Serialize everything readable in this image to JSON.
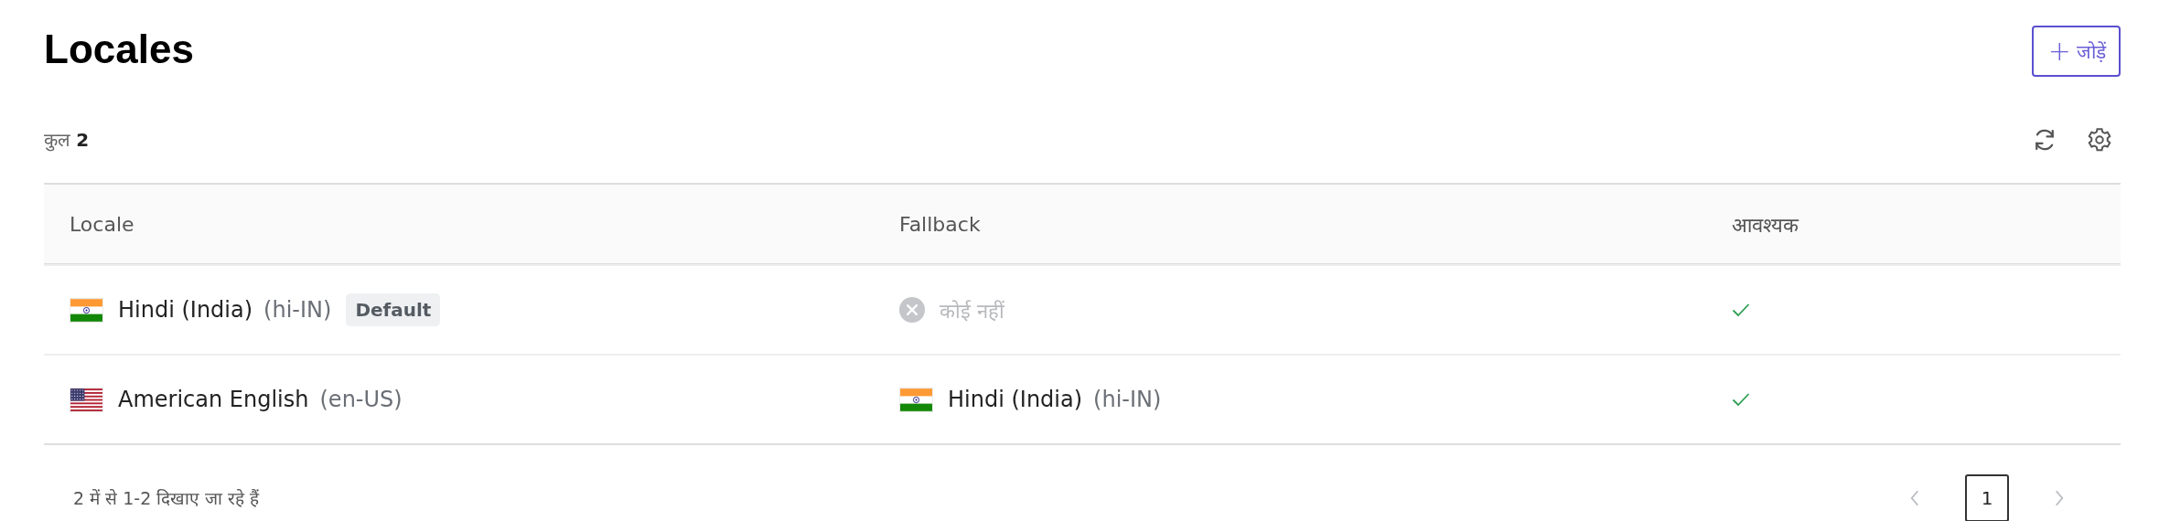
{
  "page": {
    "title": "Locales"
  },
  "add_button": {
    "icon": "+",
    "label": "जोड़ें"
  },
  "summary": "कुल **2**",
  "table": {
    "columns": [
      "Locale",
      "Fallback",
      "आवश्यक"
    ],
    "rows": [
      {
        "flag": {
          "kind": "in"
        },
        "name": "Hindi (India)",
        "code": "(hi-IN)",
        "badge": "Default",
        "fallback": {
          "kind": "none",
          "label": "कोई नहीं"
        },
        "required": true
      },
      {
        "flag": {
          "kind": "us"
        },
        "name": "American English",
        "code": "(en-US)",
        "fallback": {
          "kind": "locale",
          "flag": {
            "kind": "in"
          },
          "name": "Hindi (India)",
          "code": "(hi-IN)"
        },
        "required": true
      }
    ]
  },
  "footer": {
    "text": "2 में से 1-2 दिखाए जा रहे हैं",
    "pagination": {
      "prev_disabled": true,
      "pages": [
        {
          "label": "1",
          "selected": true
        }
      ],
      "next_disabled": true
    }
  }
}
